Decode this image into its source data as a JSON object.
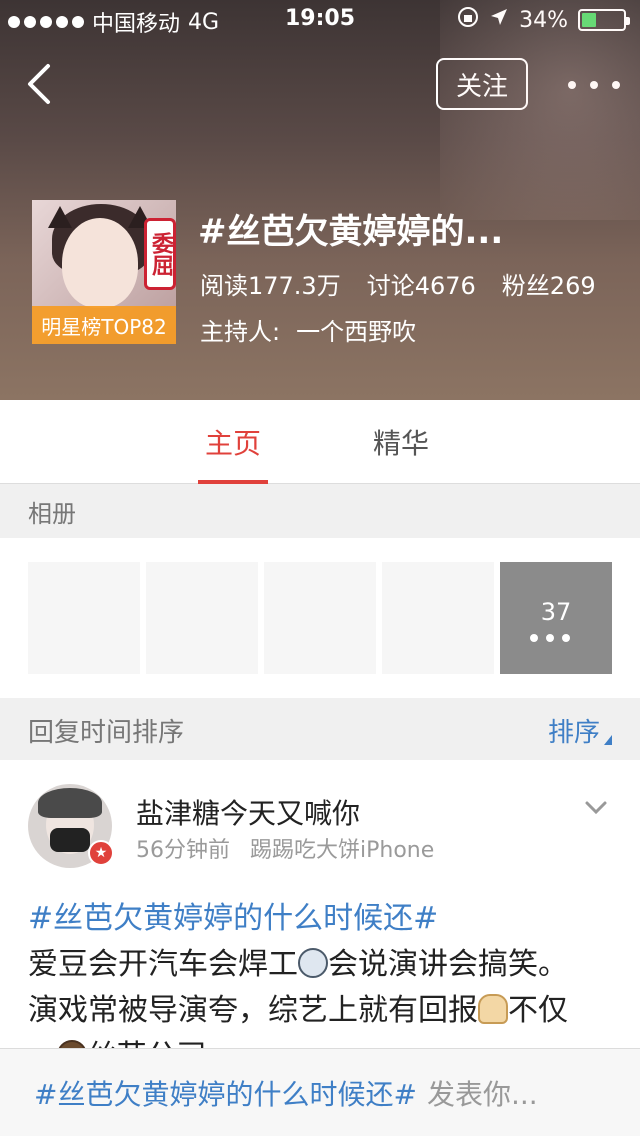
{
  "status_bar": {
    "carrier": "中国移动",
    "network": "4G",
    "time": "19:05",
    "battery_pct": "34%",
    "battery_level": 0.34
  },
  "header": {
    "follow_label": "关注",
    "title": "#丝芭欠黄婷婷的...",
    "stats": {
      "reads": "阅读177.3万",
      "discussions": "讨论4676",
      "fans": "粉丝269"
    },
    "host_label": "主持人:",
    "host_name": "一个西野吹",
    "rank_badge": "明星榜TOP82",
    "avatar_sticker": "委屈"
  },
  "tabs": [
    {
      "label": "主页",
      "active": true
    },
    {
      "label": "精华",
      "active": false
    }
  ],
  "album": {
    "label": "相册",
    "photo_count": "37"
  },
  "sort_bar": {
    "label": "回复时间排序",
    "button": "排序"
  },
  "post": {
    "username": "盐津糖今天又喊你",
    "time": "56分钟前",
    "source": "踢踢吃大饼iPhone",
    "hashtag": "#丝芭欠黄婷婷的什么时候还#",
    "text_1": "爱豆会开汽车会焊工",
    "text_2": "会说演讲会搞笑。",
    "text_3": "演戏常被导演夸，综艺上就有回报",
    "text_4": "不仅",
    "text_5": "...",
    "text_6": "丝芭公司"
  },
  "compose": {
    "hashtag": "#丝芭欠黄婷婷的什么时候还#",
    "placeholder": "发表你..."
  },
  "colors": {
    "accent_red": "#e0413b",
    "link_blue": "#3f7fc6",
    "rank_orange": "#f59b23",
    "battery_green": "#4cd964"
  },
  "icons": [
    "back-icon",
    "more-icon",
    "location-icon",
    "lock-rotation-icon",
    "dropdown-icon",
    "sort-caret-icon"
  ]
}
